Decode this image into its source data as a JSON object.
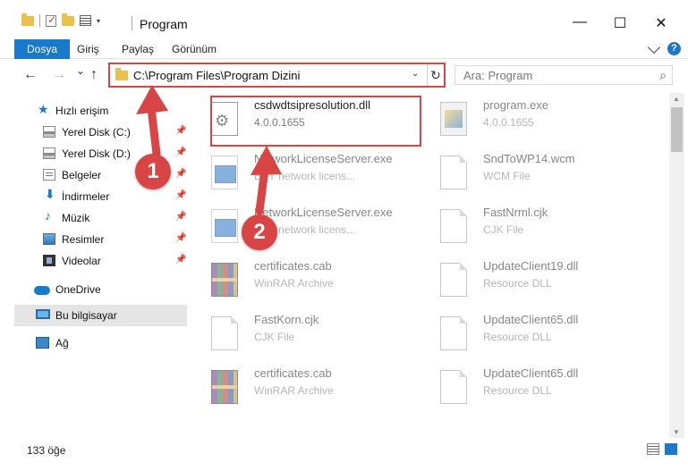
{
  "window": {
    "title": "Program",
    "controls": {
      "minimize": "—",
      "maximize": "☐",
      "close": "✕"
    }
  },
  "ribbon": {
    "tabs": [
      {
        "label": "Dosya",
        "active": true
      },
      {
        "label": "Giriş"
      },
      {
        "label": "Paylaş"
      },
      {
        "label": "Görünüm"
      }
    ],
    "help": "?"
  },
  "nav": {
    "back": "←",
    "forward": "→",
    "recent": "⌄",
    "up": "↑"
  },
  "address": {
    "path": "C:\\Program Files\\Program Dizini",
    "dropdown": "⌄",
    "refresh": "↻"
  },
  "search": {
    "placeholder": "Ara: Program",
    "icon": "⌕"
  },
  "sidebar": {
    "items": [
      {
        "label": "Hızlı erişim",
        "icon": "star-icon",
        "pinned": false
      },
      {
        "label": "Yerel Disk (C:)",
        "icon": "disk-icon",
        "pinned": true
      },
      {
        "label": "Yerel Disk (D:)",
        "icon": "disk-icon",
        "pinned": true
      },
      {
        "label": "Belgeler",
        "icon": "documents-icon",
        "pinned": true
      },
      {
        "label": "İndirmeler",
        "icon": "download-icon",
        "pinned": true
      },
      {
        "label": "Müzik",
        "icon": "music-icon",
        "pinned": true
      },
      {
        "label": "Resimler",
        "icon": "pictures-icon",
        "pinned": true
      },
      {
        "label": "Videolar",
        "icon": "videos-icon",
        "pinned": true
      },
      {
        "label": "OneDrive",
        "icon": "cloud-icon",
        "pinned": false
      },
      {
        "label": "Bu bilgisayar",
        "icon": "computer-icon",
        "pinned": false,
        "selected": true
      },
      {
        "label": "Ağ",
        "icon": "network-icon",
        "pinned": false
      }
    ],
    "pin_glyph": "📌"
  },
  "files": [
    {
      "name": "csdwdtsipresolution.dll",
      "type": "4.0.0.1655",
      "icon": "dll-gear-icon"
    },
    {
      "name": "program.exe",
      "type": "4.0.0.1655",
      "icon": "program-icon"
    },
    {
      "name": "NetworkLicenseServer.exe",
      "type": "BBY network licens...",
      "icon": "exe-icon"
    },
    {
      "name": "SndToWP14.wcm",
      "type": "WCM File",
      "icon": "file-icon"
    },
    {
      "name": "NetworkLicenseServer.exe",
      "type": "BBY network licens...",
      "icon": "exe-icon"
    },
    {
      "name": "FastNrml.cjk",
      "type": "CJK File",
      "icon": "file-icon"
    },
    {
      "name": "certificates.cab",
      "type": "WinRAR Archive",
      "icon": "winrar-icon"
    },
    {
      "name": "UpdateClient19.dll",
      "type": "Resource DLL",
      "icon": "file-icon"
    },
    {
      "name": "FastKorn.cjk",
      "type": "CJK File",
      "icon": "file-icon"
    },
    {
      "name": "UpdateClient65.dll",
      "type": "Resource DLL",
      "icon": "file-icon"
    },
    {
      "name": "certificates.cab",
      "type": "WinRAR Archive",
      "icon": "winrar-icon"
    },
    {
      "name": "UpdateClient65.dll",
      "type": "Resource DLL",
      "icon": "file-icon"
    }
  ],
  "callouts": [
    {
      "label": "1"
    },
    {
      "label": "2"
    }
  ],
  "status": {
    "item_count": "133 öğe"
  },
  "colors": {
    "accent": "#1979ca",
    "highlight": "#d94545"
  }
}
